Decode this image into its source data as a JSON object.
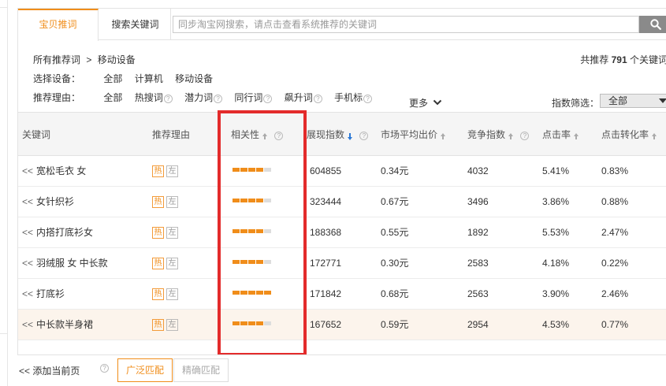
{
  "tabs": [
    {
      "label": "宝贝推词"
    },
    {
      "label": "搜索关键词"
    }
  ],
  "search": {
    "placeholder": "同步淘宝网搜索，请点击查看系统推荐的关键词",
    "icon": "search-icon"
  },
  "breadcrumb": {
    "root": "所有推荐词",
    "sep": ">",
    "current": "移动设备"
  },
  "total": {
    "prefix": "共推荐",
    "count": "791",
    "suffix": "个关键词"
  },
  "device_filter": {
    "label": "选择设备：",
    "options": [
      "全部",
      "计算机",
      "移动设备"
    ]
  },
  "reason_filter": {
    "label": "推荐理由：",
    "options": [
      "全部",
      "热搜词",
      "潜力词",
      "同行词",
      "飙升词",
      "手机标"
    ],
    "more": "更多"
  },
  "index_filter": {
    "label": "指数筛选：",
    "value": "全部"
  },
  "columns": {
    "keyword": "关键词",
    "reason": "推荐理由",
    "relevance": "相关性",
    "impressions": "展现指数",
    "avg_bid": "市场平均出价",
    "competition": "竞争指数",
    "ctr": "点击率",
    "cvr": "点击转化率"
  },
  "rows": [
    {
      "add": "<<",
      "keyword": "宽松毛衣 女",
      "tag1": "热",
      "tag2": "左",
      "relevance": 4,
      "impressions": "604855",
      "avg_bid": "0.34元",
      "competition": "4032",
      "ctr": "5.41%",
      "cvr": "0.83%"
    },
    {
      "add": "<<",
      "keyword": "女针织衫",
      "tag1": "热",
      "tag2": "左",
      "relevance": 4,
      "impressions": "323444",
      "avg_bid": "0.67元",
      "competition": "3496",
      "ctr": "3.86%",
      "cvr": "0.88%"
    },
    {
      "add": "<<",
      "keyword": "内搭打底衫女",
      "tag1": "热",
      "tag2": "左",
      "relevance": 4,
      "impressions": "188368",
      "avg_bid": "0.55元",
      "competition": "1892",
      "ctr": "5.53%",
      "cvr": "2.47%"
    },
    {
      "add": "<<",
      "keyword": "羽绒服 女 中长款",
      "tag1": "热",
      "tag2": "左",
      "relevance": 4,
      "impressions": "172771",
      "avg_bid": "0.30元",
      "competition": "2583",
      "ctr": "4.18%",
      "cvr": "0.22%"
    },
    {
      "add": "<<",
      "keyword": "打底衫",
      "tag1": "热",
      "tag2": "左",
      "relevance": 5,
      "impressions": "171842",
      "avg_bid": "0.68元",
      "competition": "2563",
      "ctr": "3.90%",
      "cvr": "2.46%"
    },
    {
      "add": "<<",
      "keyword": "中长款半身裙",
      "tag1": "热",
      "tag2": "左",
      "relevance": 4,
      "impressions": "167652",
      "avg_bid": "0.59元",
      "competition": "2954",
      "ctr": "4.53%",
      "cvr": "0.77%"
    }
  ],
  "footer": {
    "add_page": "<< 添加当前页",
    "broad_match": "广泛匹配",
    "exact_match": "精确匹配"
  },
  "colors": {
    "accent": "#f08d1a",
    "highlight_border": "#e32b2b",
    "sort_active": "#2a78d6"
  }
}
